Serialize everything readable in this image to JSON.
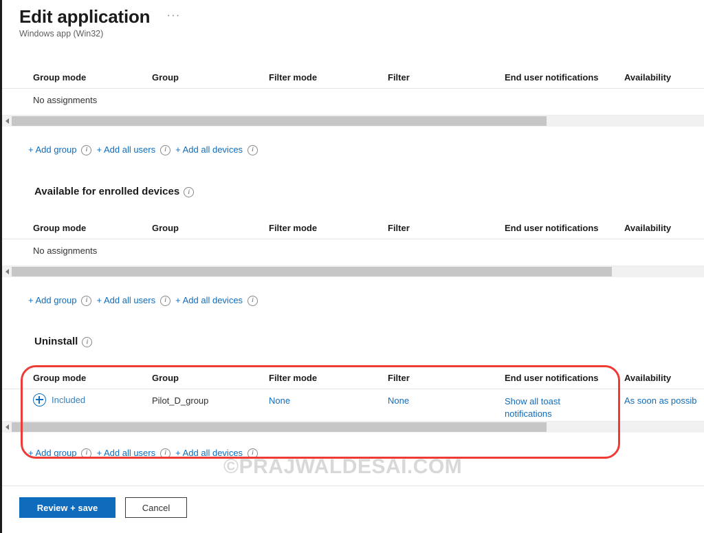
{
  "header": {
    "title": "Edit application",
    "ellipsis": "···",
    "subtitle": "Windows app (Win32)"
  },
  "columns": {
    "group_mode": "Group mode",
    "group": "Group",
    "filter_mode": "Filter mode",
    "filter": "Filter",
    "end_user_notifications": "End user notifications",
    "availability": "Availability"
  },
  "add_links": {
    "add_group": "+ Add group",
    "add_all_users": "+ Add all users",
    "add_all_devices": "+ Add all devices",
    "info_icon": "info-icon"
  },
  "sections": [
    {
      "id": "required",
      "heading": "",
      "empty_text": "No assignments",
      "scrollbar": {
        "thumb_width": 778
      }
    },
    {
      "id": "available-enrolled",
      "heading": "Available for enrolled devices",
      "empty_text": "No assignments",
      "scrollbar": {
        "thumb_width": 873
      }
    },
    {
      "id": "uninstall",
      "heading": "Uninstall",
      "scrollbar": {
        "thumb_width": 778
      },
      "row": {
        "group_mode": "Included",
        "group_mode_icon": "plus-circle-icon",
        "group": "Pilot_D_group",
        "filter_mode": "None",
        "filter": "None",
        "end_user_notifications": "Show all toast notifications",
        "availability": "As soon as possib"
      }
    }
  ],
  "highlight": {
    "color": "#ee3b36"
  },
  "watermark": {
    "text": "©PRAJWALDESAI.COM"
  },
  "footer": {
    "review_save": "Review + save",
    "cancel": "Cancel",
    "primary_color": "#0f6cbd"
  }
}
